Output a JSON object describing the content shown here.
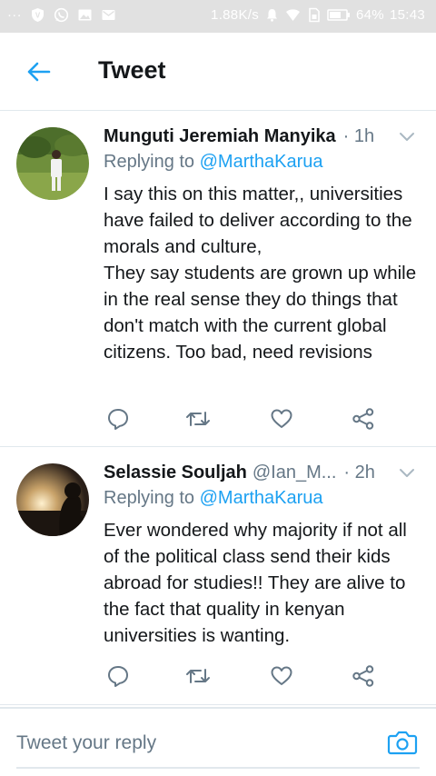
{
  "status_bar": {
    "dots": "···",
    "speed": "1.88K/s",
    "battery": "64%",
    "time": "15:43",
    "icons": [
      "vpn-icon",
      "whatsapp-icon",
      "image-icon",
      "mail-icon",
      "alarm-icon",
      "wifi-icon",
      "sim-icon",
      "battery-icon"
    ]
  },
  "header": {
    "title": "Tweet",
    "back_icon": "arrow-left-icon",
    "accent": "#1da1f2"
  },
  "tweets": [
    {
      "name": "Munguti Jeremiah Manyika",
      "handle": "",
      "time": "· 1h",
      "replying_prefix": "Replying to",
      "replying_handle": "@MarthaKarua",
      "text": "I say this on this matter,, universities have failed to deliver according to the morals and culture,\nThey say students are grown up while in the real sense they do things that don't match with the current global citizens. Too bad, need revisions"
    },
    {
      "name": "Selassie Souljah",
      "handle": "@Ian_M...",
      "time": "· 2h",
      "replying_prefix": "Replying to",
      "replying_handle": "@MarthaKarua",
      "text": "Ever wondered why majority if not all of the political class send their kids abroad for studies!! They are alive to the fact that quality in kenyan universities is wanting."
    }
  ],
  "actions": [
    "reply-icon",
    "retweet-icon",
    "like-icon",
    "share-icon"
  ],
  "compose": {
    "placeholder": "Tweet your reply",
    "camera_icon": "camera-icon"
  }
}
